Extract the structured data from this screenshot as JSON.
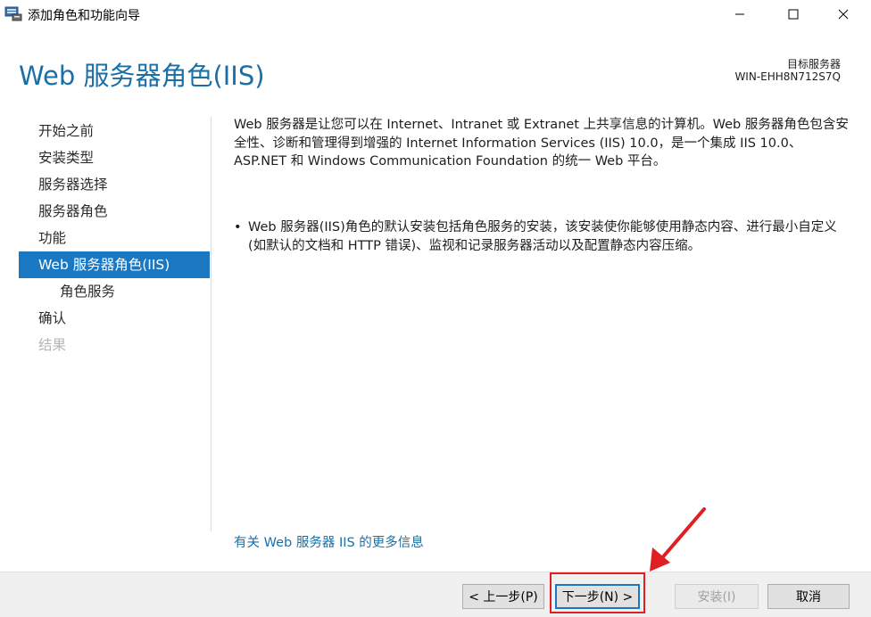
{
  "window": {
    "title": "添加角色和功能向导",
    "minimize_glyph": "—",
    "maximize_glyph": "☐",
    "close_glyph": "✕"
  },
  "header": {
    "heading": "Web 服务器角色(IIS)",
    "destination_label": "目标服务器",
    "destination_server": "WIN-EHH8N712S7Q"
  },
  "nav": {
    "items": [
      {
        "label": "开始之前",
        "state": "normal"
      },
      {
        "label": "安装类型",
        "state": "normal"
      },
      {
        "label": "服务器选择",
        "state": "normal"
      },
      {
        "label": "服务器角色",
        "state": "normal"
      },
      {
        "label": "功能",
        "state": "normal"
      },
      {
        "label": "Web 服务器角色(IIS)",
        "state": "active"
      },
      {
        "label": "角色服务",
        "state": "sub"
      },
      {
        "label": "确认",
        "state": "normal"
      },
      {
        "label": "结果",
        "state": "disabled"
      }
    ]
  },
  "content": {
    "description": "Web 服务器是让您可以在 Internet、Intranet 或 Extranet 上共享信息的计算机。Web 服务器角色包含安全性、诊断和管理得到增强的 Internet Information Services (IIS) 10.0，是一个集成 IIS 10.0、ASP.NET 和 Windows Communication Foundation 的统一 Web 平台。",
    "bullet_glyph": "•",
    "bullet": "Web 服务器(IIS)角色的默认安装包括角色服务的安装，该安装使你能够使用静态内容、进行最小自定义(如默认的文档和 HTTP 错误)、监视和记录服务器活动以及配置静态内容压缩。",
    "more_link": "有关 Web 服务器 IIS 的更多信息"
  },
  "footer": {
    "prev_label": "< 上一步(P)",
    "next_label": "下一步(N) >",
    "install_label": "安装(I)",
    "cancel_label": "取消"
  },
  "colors": {
    "accent": "#1a78c2",
    "heading": "#1a6fa6",
    "annotation": "#e01f25"
  },
  "icons": {
    "app": "server-manager-icon",
    "annotation_arrow": "red-arrow-annotation"
  }
}
